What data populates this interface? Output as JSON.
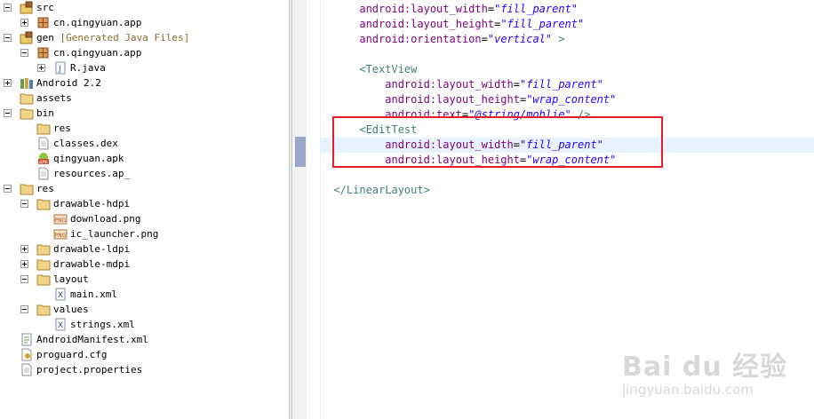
{
  "package_explorer": {
    "items": [
      {
        "label": "src",
        "type": "src-folder",
        "expander": "minus"
      },
      {
        "label": "cn.qingyuan.app",
        "type": "package",
        "expander": "plus"
      },
      {
        "label": "gen",
        "extra": "[Generated Java Files]",
        "type": "src-folder",
        "expander": "minus"
      },
      {
        "label": "cn.qingyuan.app",
        "type": "package",
        "expander": "minus"
      },
      {
        "label": "R.java",
        "type": "java-file",
        "expander": "plus"
      },
      {
        "label": "Android 2.2",
        "type": "library",
        "expander": "plus"
      },
      {
        "label": "assets",
        "type": "folder",
        "expander": "none"
      },
      {
        "label": "bin",
        "type": "folder",
        "expander": "minus"
      },
      {
        "label": "res",
        "type": "folder",
        "expander": "none"
      },
      {
        "label": "classes.dex",
        "type": "file",
        "expander": "none"
      },
      {
        "label": "qingyuan.apk",
        "type": "apk",
        "expander": "none"
      },
      {
        "label": "resources.ap_",
        "type": "file",
        "expander": "none"
      },
      {
        "label": "res",
        "type": "folder",
        "expander": "minus"
      },
      {
        "label": "drawable-hdpi",
        "type": "folder",
        "expander": "minus"
      },
      {
        "label": "download.png",
        "type": "png",
        "expander": "none"
      },
      {
        "label": "ic_launcher.png",
        "type": "png",
        "expander": "none"
      },
      {
        "label": "drawable-ldpi",
        "type": "folder",
        "expander": "plus"
      },
      {
        "label": "drawable-mdpi",
        "type": "folder",
        "expander": "plus"
      },
      {
        "label": "layout",
        "type": "folder",
        "expander": "minus"
      },
      {
        "label": "main.xml",
        "type": "xml",
        "expander": "none"
      },
      {
        "label": "values",
        "type": "folder",
        "expander": "minus"
      },
      {
        "label": "strings.xml",
        "type": "xml",
        "expander": "none"
      },
      {
        "label": "AndroidManifest.xml",
        "type": "manifest",
        "expander": "none"
      },
      {
        "label": "proguard.cfg",
        "type": "cfg",
        "expander": "none"
      },
      {
        "label": "project.properties",
        "type": "file",
        "expander": "none"
      }
    ]
  },
  "editor": {
    "lines": [
      {
        "indent": "    ",
        "attr": "android:layout_width",
        "value": "\"fill_parent\"",
        "tail": ""
      },
      {
        "indent": "    ",
        "attr": "android:layout_height",
        "value": "\"fill_parent\"",
        "tail": ""
      },
      {
        "indent": "    ",
        "attr": "android:orientation",
        "value": "\"vertical\"",
        "tail": " >"
      },
      {
        "indent": "",
        "text": ""
      },
      {
        "indent": "    ",
        "tag": "<TextView",
        "text": ""
      },
      {
        "indent": "        ",
        "attr": "android:layout_width",
        "value": "\"fill_parent\"",
        "tail": ""
      },
      {
        "indent": "        ",
        "attr": "android:layout_height",
        "value": "\"wrap_content\"",
        "tail": ""
      },
      {
        "indent": "        ",
        "attr": "android:text",
        "value": "\"@string/moblie\"",
        "tail": " />"
      },
      {
        "indent": "    ",
        "tag": "<EditTest",
        "text": ""
      },
      {
        "indent": "        ",
        "attr": "android:layout_width",
        "value": "\"fill_parent\"",
        "tail": "",
        "highlight": true
      },
      {
        "indent": "        ",
        "attr": "android:layout_height",
        "value": "\"wrap_content\"",
        "tail": ""
      },
      {
        "indent": "",
        "text": ""
      },
      {
        "indent": "",
        "tag": "</LinearLayout>",
        "text": ""
      }
    ]
  },
  "watermark": {
    "brand": "Bai du 经验",
    "site": "jingyuan.baidu.com"
  },
  "colors": {
    "tag": "#3f7f7f",
    "attr": "#7f007f",
    "value": "#2a00ff",
    "annotation_box": "#e0202a",
    "current_line": "#e8f2fe"
  }
}
